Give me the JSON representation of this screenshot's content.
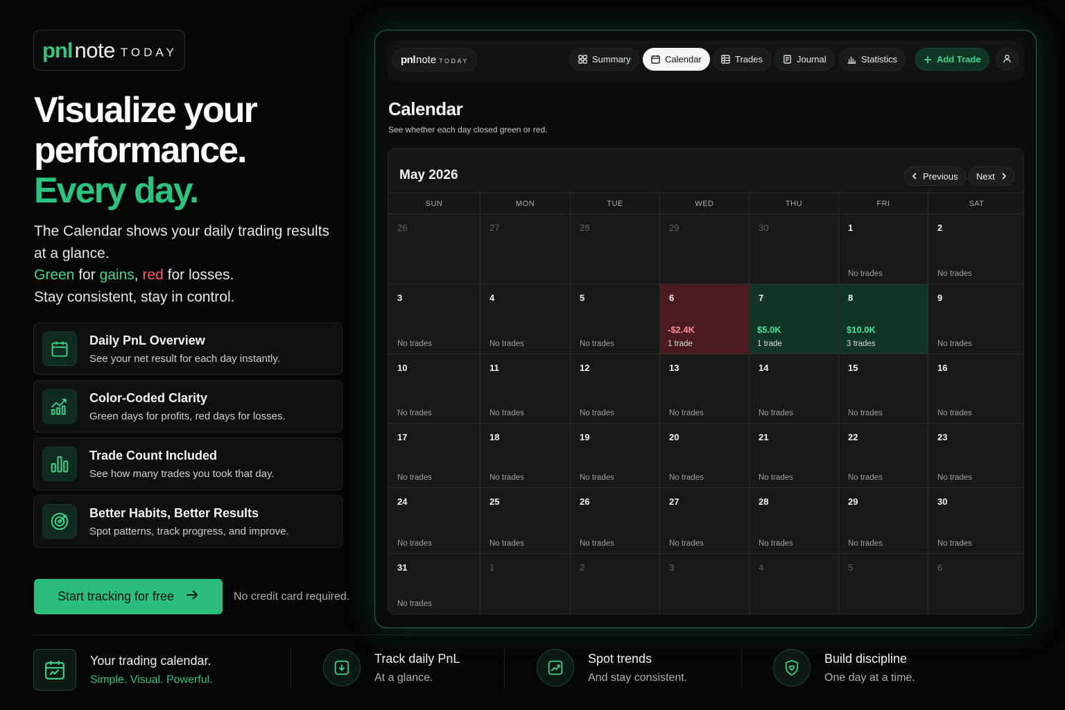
{
  "brand": {
    "pnl": "pnl",
    "note": "note",
    "today": "TODAY"
  },
  "hero": {
    "line1": "Visualize your",
    "line2": "performance.",
    "line3": "Every day."
  },
  "description": {
    "line1": "The Calendar shows your daily trading results at a glance.",
    "green_word": "Green",
    "for1": " for ",
    "gains_word": "gains",
    "comma": ", ",
    "red_word": "red",
    "for2": " for losses.",
    "line3": "Stay consistent, stay in control."
  },
  "features": [
    {
      "icon": "calendar-icon",
      "title": "Daily PnL Overview",
      "desc": "See your net result for each day instantly."
    },
    {
      "icon": "trend-chart-icon",
      "title": "Color-Coded Clarity",
      "desc": "Green days for profits, red days for losses."
    },
    {
      "icon": "bar-chart-icon",
      "title": "Trade Count Included",
      "desc": "See how many trades you took that day."
    },
    {
      "icon": "target-icon",
      "title": "Better Habits, Better Results",
      "desc": "Spot patterns, track progress, and improve."
    }
  ],
  "cta": {
    "label": "Start tracking for free",
    "note": "No credit card required."
  },
  "app": {
    "logo": {
      "pnl": "pnl",
      "note": "note",
      "today": "TODAY"
    },
    "nav": [
      {
        "label": "Summary",
        "icon": "grid-icon",
        "active": false
      },
      {
        "label": "Calendar",
        "icon": "calendar-icon",
        "active": true
      },
      {
        "label": "Trades",
        "icon": "table-icon",
        "active": false
      },
      {
        "label": "Journal",
        "icon": "journal-icon",
        "active": false
      },
      {
        "label": "Statistics",
        "icon": "bar-chart-icon",
        "active": false
      }
    ],
    "add_trade": "Add Trade",
    "user_icon": "user-icon",
    "page_title": "Calendar",
    "page_subtitle": "See whether each day closed green or red."
  },
  "calendar": {
    "month": "May 2026",
    "previous": "Previous",
    "next": "Next",
    "weekdays": [
      "SUN",
      "MON",
      "TUE",
      "WED",
      "THU",
      "FRI",
      "SAT"
    ],
    "weeks": [
      [
        {
          "day": "26",
          "outside": true
        },
        {
          "day": "27",
          "outside": true
        },
        {
          "day": "28",
          "outside": true
        },
        {
          "day": "29",
          "outside": true
        },
        {
          "day": "30",
          "outside": true
        },
        {
          "day": "1",
          "note": "No trades"
        },
        {
          "day": "2",
          "note": "No trades"
        }
      ],
      [
        {
          "day": "3",
          "note": "No trades"
        },
        {
          "day": "4",
          "note": "No trades"
        },
        {
          "day": "5",
          "note": "No trades"
        },
        {
          "day": "6",
          "status": "loss",
          "pnl": "-$2.4K",
          "trades": "1 trade"
        },
        {
          "day": "7",
          "status": "gain",
          "pnl": "$5.0K",
          "trades": "1 trade"
        },
        {
          "day": "8",
          "status": "gain",
          "pnl": "$10.0K",
          "trades": "3 trades"
        },
        {
          "day": "9",
          "note": "No trades"
        }
      ],
      [
        {
          "day": "10",
          "note": "No trades"
        },
        {
          "day": "11",
          "note": "No trades"
        },
        {
          "day": "12",
          "note": "No trades"
        },
        {
          "day": "13",
          "note": "No trades"
        },
        {
          "day": "14",
          "note": "No trades"
        },
        {
          "day": "15",
          "note": "No trades"
        },
        {
          "day": "16",
          "note": "No trades"
        }
      ],
      [
        {
          "day": "17",
          "note": "No trades"
        },
        {
          "day": "18",
          "note": "No trades"
        },
        {
          "day": "19",
          "note": "No trades"
        },
        {
          "day": "20",
          "note": "No trades"
        },
        {
          "day": "21",
          "note": "No trades"
        },
        {
          "day": "22",
          "note": "No trades"
        },
        {
          "day": "23",
          "note": "No trades"
        }
      ],
      [
        {
          "day": "24",
          "note": "No trades"
        },
        {
          "day": "25",
          "note": "No trades"
        },
        {
          "day": "26",
          "note": "No trades"
        },
        {
          "day": "27",
          "note": "No trades"
        },
        {
          "day": "28",
          "note": "No trades"
        },
        {
          "day": "29",
          "note": "No trades"
        },
        {
          "day": "30",
          "note": "No trades"
        }
      ],
      [
        {
          "day": "31",
          "note": "No trades"
        },
        {
          "day": "1",
          "outside": true
        },
        {
          "day": "2",
          "outside": true
        },
        {
          "day": "3",
          "outside": true
        },
        {
          "day": "4",
          "outside": true
        },
        {
          "day": "5",
          "outside": true
        },
        {
          "day": "6",
          "outside": true
        }
      ]
    ]
  },
  "bottom": [
    {
      "icon": "calendar-chart-icon",
      "title": "Your trading calendar.",
      "subtitle": "Simple. Visual. Powerful."
    },
    {
      "icon": "download-chart-icon",
      "title": "Track daily PnL",
      "subtitle": "At a glance."
    },
    {
      "icon": "trend-up-icon",
      "title": "Spot trends",
      "subtitle": "And stay consistent."
    },
    {
      "icon": "shield-heart-icon",
      "title": "Build discipline",
      "subtitle": "One day at a time."
    }
  ],
  "colors": {
    "accent": "#2bbd7b",
    "gain_bg": "#123526",
    "loss_bg": "#4a1c22",
    "frame_glow": "#1e6a46"
  }
}
